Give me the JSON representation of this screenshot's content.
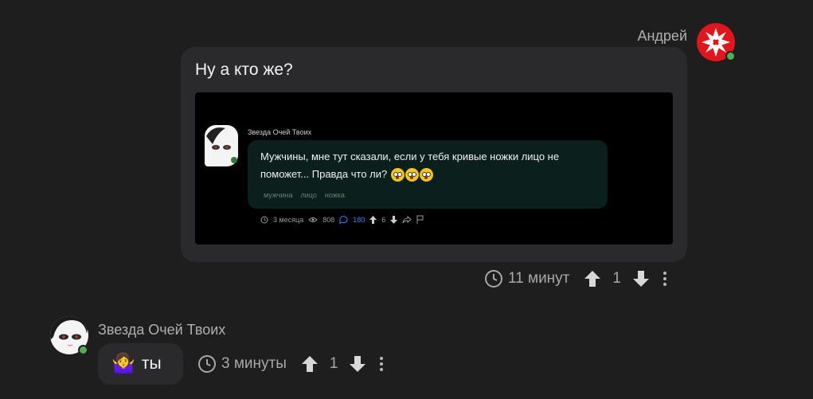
{
  "colors": {
    "background": "#1e1e1f",
    "bubble": "#2a2a2c",
    "online": "#4caf50",
    "embed_link": "#3b82f6"
  },
  "message1": {
    "author": "Андрей",
    "text": "Ну а кто же?",
    "attachment": {
      "author": "Звезда Очей Твоих",
      "text_line1": "Мужчины, мне тут сказали, если у тебя кривые ножки лицо не",
      "text_line2": "поможет... Правда что ли?",
      "emojis": [
        "flushed-face",
        "flushed-face",
        "flushed-face"
      ],
      "tags": [
        "мужчина",
        "лицо",
        "ножка"
      ],
      "time": "3 месяца",
      "views": "808",
      "comments": "180",
      "rating": "6"
    },
    "time": "11 минут",
    "rating": "1"
  },
  "message2": {
    "author": "Звезда Очей Твоих",
    "emoji": "🤷‍♀️",
    "text": "ты",
    "time": "3 минуты",
    "rating": "1"
  }
}
